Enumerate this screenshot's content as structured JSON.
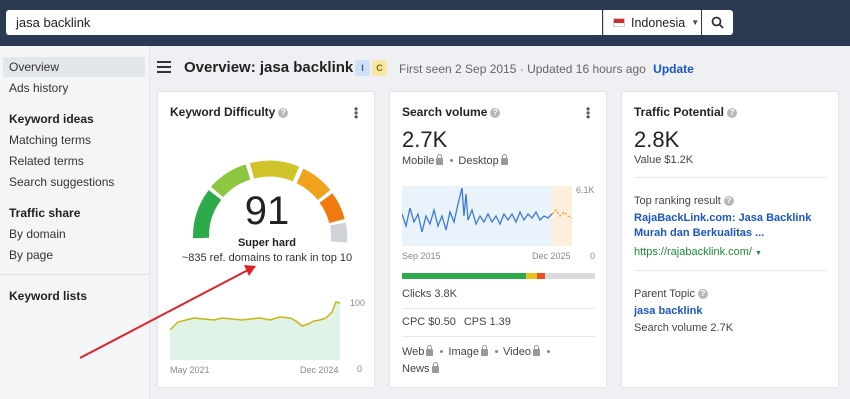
{
  "search": {
    "query": "jasa backlink",
    "country": "Indonesia"
  },
  "sidebar": {
    "overview": "Overview",
    "ads_history": "Ads history",
    "keyword_ideas_header": "Keyword ideas",
    "matching_terms": "Matching terms",
    "related_terms": "Related terms",
    "search_suggestions": "Search suggestions",
    "traffic_share_header": "Traffic share",
    "by_domain": "By domain",
    "by_page": "By page",
    "keyword_lists": "Keyword lists"
  },
  "header": {
    "title": "Overview: jasa backlink",
    "badge_i": "I",
    "badge_c": "C",
    "meta": "First seen 2 Sep 2015 · Updated 16 hours ago",
    "update": "Update"
  },
  "kd": {
    "title": "Keyword Difficulty",
    "score": "91",
    "label": "Super hard",
    "sub": "~835 ref. domains to rank in top 10",
    "chart_ymax": "100",
    "chart_ymin": "0",
    "chart_start": "May 2021",
    "chart_end": "Dec 2024"
  },
  "sv": {
    "title": "Search volume",
    "value": "2.7K",
    "devices": {
      "mobile": "Mobile",
      "desktop": "Desktop"
    },
    "chart_ymax": "6.1K",
    "chart_ymin": "0",
    "chart_start": "Sep 2015",
    "chart_end": "Dec 2025",
    "clicks": "Clicks 3.8K",
    "cpc": "CPC $0.50",
    "cps": "CPS 1.39",
    "serp": {
      "web": "Web",
      "image": "Image",
      "video": "Video",
      "news": "News"
    }
  },
  "tp": {
    "title": "Traffic Potential",
    "value": "2.8K",
    "sub": "Value $1.2K",
    "top_label": "Top ranking result",
    "top_title_1": "RajaBackLink.com: Jasa Backlink",
    "top_title_2": "Murah dan Berkualitas ...",
    "top_url": "https://rajabacklink.com/",
    "parent_label": "Parent Topic",
    "parent_value": "jasa backlink",
    "parent_sv": "Search volume 2.7K"
  },
  "colors": {
    "topbar": "#2a3a52",
    "accent": "#1a56c4",
    "annotation_arrow": "#e0202a"
  }
}
